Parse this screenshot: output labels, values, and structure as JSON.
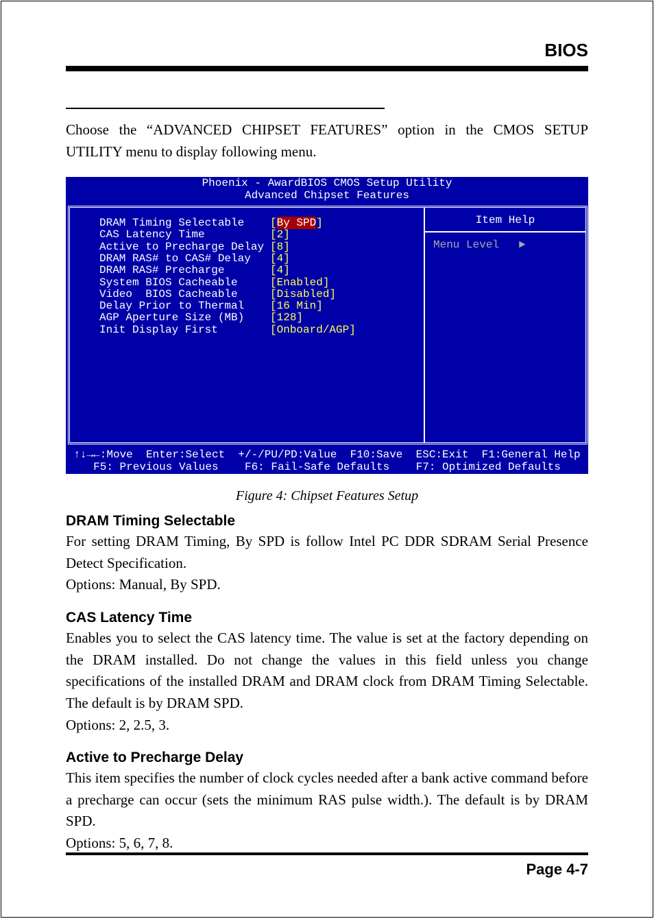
{
  "header": {
    "title": "BIOS"
  },
  "intro": "Choose the “ADVANCED CHIPSET FEATURES” option  in the CMOS SETUP UTILITY menu to display following menu.",
  "bios": {
    "colors": {
      "background": "#0000a8",
      "value": "#ffff55",
      "highlight": "#a80000",
      "disabled_text": "#a8a8a8"
    },
    "title1": "Phoenix - AwardBIOS CMOS Setup Utility",
    "title2": "Advanced Chipset Features",
    "items": [
      {
        "label": "DRAM Timing Selectable",
        "value": "By SPD",
        "selected": true
      },
      {
        "label": "CAS Latency Time",
        "value": "2"
      },
      {
        "label": "Active to Precharge Delay",
        "value": "8"
      },
      {
        "label": "DRAM RAS# to CAS# Delay",
        "value": "4"
      },
      {
        "label": "DRAM RAS# Precharge",
        "value": "4"
      },
      {
        "label": "System BIOS Cacheable",
        "value": "Enabled"
      },
      {
        "label": "Video  BIOS Cacheable",
        "value": "Disabled"
      },
      {
        "label": "Delay Prior to Thermal",
        "value": "16 Min"
      },
      {
        "label": "AGP Aperture Size (MB)",
        "value": "128"
      },
      {
        "label": "Init Display First",
        "value": "Onboard/AGP"
      }
    ],
    "item_help": "Item Help",
    "menu_level": "Menu Level   ►",
    "footer1": "↑↓→←:Move  Enter:Select  +/-/PU/PD:Value  F10:Save  ESC:Exit  F1:General Help",
    "footer2": "F5: Previous Values    F6: Fail-Safe Defaults    F7: Optimized Defaults"
  },
  "caption": "Figure 4:  Chipset Features Setup",
  "sections": [
    {
      "title": "DRAM Timing Selectable",
      "lines": [
        "For setting DRAM Timing, By SPD is follow Intel PC DDR SDRAM Serial Presence Detect Specification.",
        "Options: Manual, By SPD."
      ]
    },
    {
      "title": "CAS Latency Time",
      "lines": [
        "Enables you to select the CAS latency time. The value is set at the factory depending on the DRAM installed. Do not change the values in this field unless you change specifications of the installed DRAM and DRAM clock from DRAM Timing Selectable. The default is by DRAM SPD.",
        "Options: 2, 2.5, 3."
      ]
    },
    {
      "title": "Active to Precharge Delay",
      "lines": [
        "This item specifies the number of clock cycles needed after a bank active command before a precharge can occur (sets the minimum RAS pulse width.). The default is by DRAM SPD.",
        "Options: 5, 6, 7, 8."
      ]
    }
  ],
  "footer": {
    "page": "Page 4-7"
  }
}
